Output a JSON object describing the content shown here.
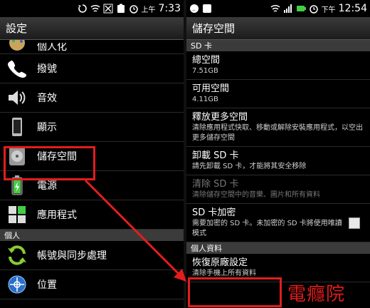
{
  "left": {
    "status": {
      "ampm": "上午",
      "time": "7:33"
    },
    "title": "設定",
    "partial_item": {
      "label": "個人化",
      "icon": "personalize-icon"
    },
    "items": [
      {
        "label": "撥號",
        "icon": "phone-icon"
      },
      {
        "label": "音效",
        "icon": "speaker-icon"
      },
      {
        "label": "顯示",
        "icon": "display-icon"
      },
      {
        "label": "儲存空間",
        "icon": "storage-disk-icon"
      },
      {
        "label": "電源",
        "icon": "battery-icon"
      },
      {
        "label": "應用程式",
        "icon": "apps-icon"
      }
    ],
    "section_personal": "個人",
    "items2": [
      {
        "label": "帳號與同步處理",
        "icon": "sync-icon"
      },
      {
        "label": "位置",
        "icon": "location-icon"
      }
    ]
  },
  "right": {
    "status": {
      "ampm": "下午",
      "time": "12:54"
    },
    "title": "儲存空間",
    "section_sd": "SD 卡",
    "total": {
      "title": "總空間",
      "value": "7.51GB"
    },
    "available": {
      "title": "可用空間",
      "value": "4.11GB"
    },
    "free_more": {
      "title": "釋放更多空間",
      "desc": "清除應用程式快取、移動或解除安裝應用程式，以空出更多儲存空間"
    },
    "unmount": {
      "title": "卸載 SD 卡",
      "desc": "請先卸載 SD 卡，才能將其安全移除"
    },
    "erase": {
      "title": "清除 SD 卡",
      "desc": "清除儲存空間中的音樂、圖片和所有資料"
    },
    "encrypt": {
      "title": "SD 卡加密",
      "desc": "需要加密的 SD 卡。未加密的 SD 卡將使用唯讀模式"
    },
    "section_personal_data": "個人資料",
    "factory_reset": {
      "title": "恢復原廠設定",
      "desc": "清除手機上所有資料"
    }
  },
  "watermark": "電癮院",
  "colors": {
    "highlight": "#e21d1d",
    "background": "#000000"
  }
}
